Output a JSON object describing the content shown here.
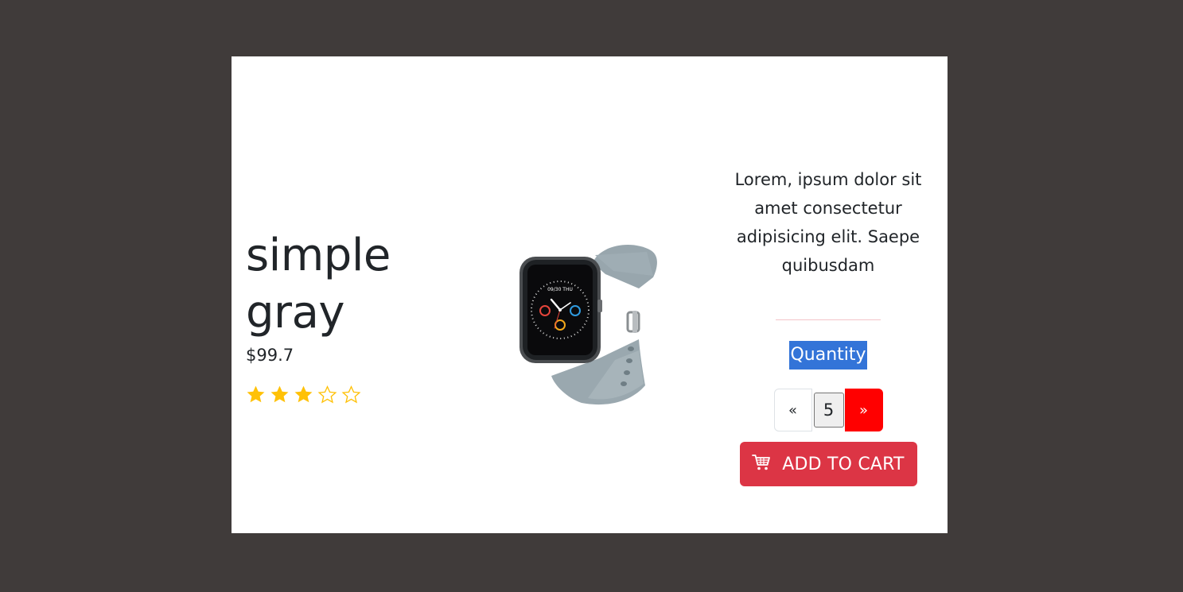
{
  "product": {
    "name": "simple gray",
    "price": "$99.7",
    "rating": 3,
    "rating_max": 5,
    "image_icon": "smartwatch-image",
    "description": "Lorem, ipsum dolor sit amet consectetur adipisicing elit. Saepe quibusdam"
  },
  "quantity": {
    "label": "Quantity",
    "prev_label": "«",
    "value": "5",
    "next_label": "»"
  },
  "cart_button": {
    "label": "ADD TO CART",
    "icon": "cart-icon"
  },
  "colors": {
    "backdrop": "#403b3a",
    "star": "#ffc107",
    "cart_button": "#dc3545",
    "next_button": "#ff0000",
    "selection": "#3374d8"
  }
}
